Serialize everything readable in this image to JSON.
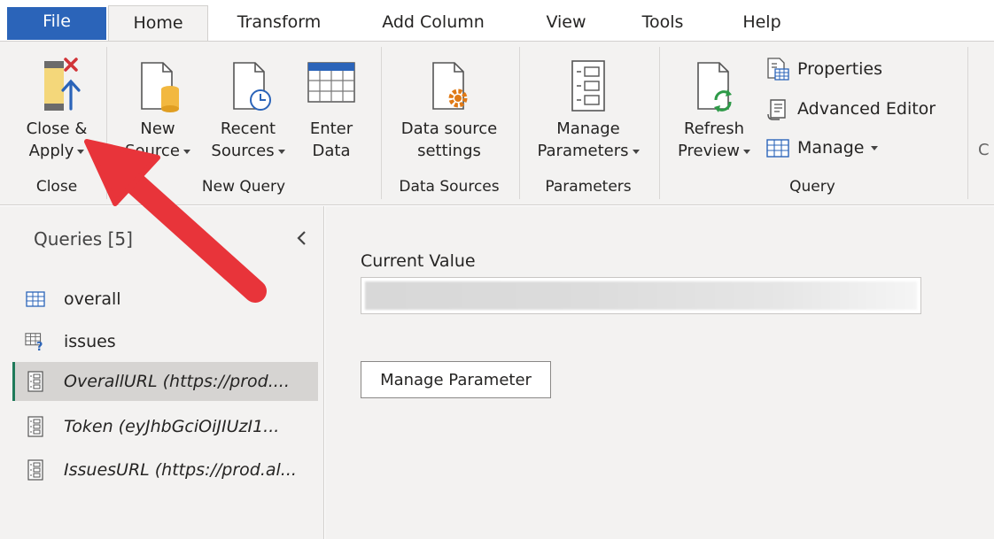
{
  "tabs": {
    "file": "File",
    "home": "Home",
    "transform": "Transform",
    "add_column": "Add Column",
    "view": "View",
    "tools": "Tools",
    "help": "Help"
  },
  "ribbon": {
    "close_apply": {
      "line1": "Close &",
      "line2": "Apply"
    },
    "new_source": {
      "line1": "New",
      "line2": "Source"
    },
    "recent_sources": {
      "line1": "Recent",
      "line2": "Sources"
    },
    "enter_data": {
      "line1": "Enter",
      "line2": "Data"
    },
    "data_source_settings": {
      "line1": "Data source",
      "line2": "settings"
    },
    "manage_parameters": {
      "line1": "Manage",
      "line2": "Parameters"
    },
    "refresh_preview": {
      "line1": "Refresh",
      "line2": "Preview"
    },
    "properties": "Properties",
    "advanced_editor": "Advanced Editor",
    "manage": "Manage",
    "partial_cut": "C",
    "groups": {
      "close": "Close",
      "new_query": "New Query",
      "data_sources": "Data Sources",
      "parameters": "Parameters",
      "query": "Query"
    }
  },
  "queries": {
    "title": "Queries [5]",
    "items": [
      {
        "name": "overall",
        "icon": "table-icon"
      },
      {
        "name": "issues",
        "icon": "table-question-icon"
      },
      {
        "name": "OverallURL (https://prod....",
        "icon": "parameter-icon"
      },
      {
        "name": "Token (eyJhbGciOiJIUzI1...",
        "icon": "parameter-icon"
      },
      {
        "name": "IssuesURL (https://prod.al...",
        "icon": "parameter-icon"
      }
    ]
  },
  "main": {
    "current_value_label": "Current Value",
    "manage_parameter_button": "Manage Parameter"
  },
  "colors": {
    "file_tab": "#2b64b9",
    "ribbon_bg": "#f3f2f1",
    "selected_indicator": "#1f7a5a",
    "arrow": "#e8343a"
  }
}
